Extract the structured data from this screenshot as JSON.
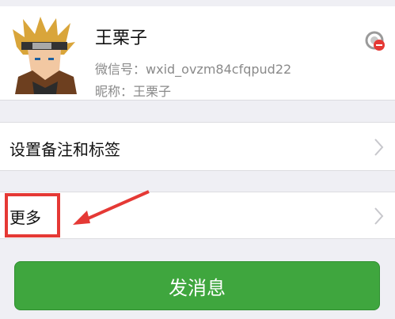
{
  "profile": {
    "name": "王栗子",
    "wxid_label": "微信号：",
    "wxid_value": "wxid_ovzm84cfqpud22",
    "nickname_label": "昵称：",
    "nickname_value": "王栗子",
    "avatar_icon": "avatar-image",
    "star_icon": "star-icon"
  },
  "rows": {
    "remark_tags_label": "设置备注和标签",
    "more_label": "更多"
  },
  "actions": {
    "send_message_label": "发消息"
  },
  "colors": {
    "accent_green": "#3fa63e",
    "highlight_red": "#e53935",
    "background": "#efeff4"
  }
}
